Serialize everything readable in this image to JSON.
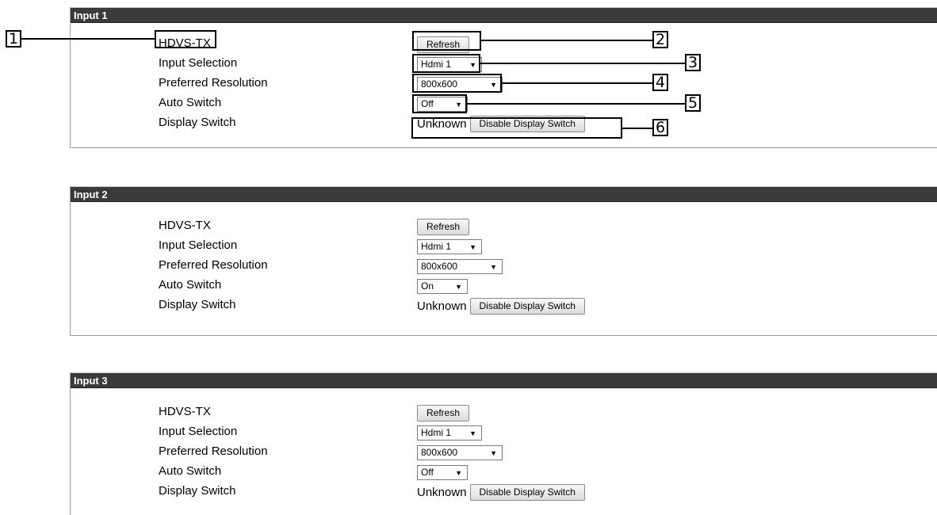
{
  "panels": [
    {
      "title": "Input 1",
      "rows": {
        "hdvs_label": "HDVS-TX",
        "refresh_label": "Refresh",
        "input_selection_label": "Input Selection",
        "input_selection_value": "Hdmi 1",
        "preferred_resolution_label": "Preferred Resolution",
        "preferred_resolution_value": "800x600",
        "auto_switch_label": "Auto Switch",
        "auto_switch_value": "Off",
        "display_switch_label": "Display Switch",
        "display_switch_status": "Unknown",
        "display_switch_button": "Disable Display Switch"
      }
    },
    {
      "title": "Input 2",
      "rows": {
        "hdvs_label": "HDVS-TX",
        "refresh_label": "Refresh",
        "input_selection_label": "Input Selection",
        "input_selection_value": "Hdmi 1",
        "preferred_resolution_label": "Preferred Resolution",
        "preferred_resolution_value": "800x600",
        "auto_switch_label": "Auto Switch",
        "auto_switch_value": "On",
        "display_switch_label": "Display Switch",
        "display_switch_status": "Unknown",
        "display_switch_button": "Disable Display Switch"
      }
    },
    {
      "title": "Input 3",
      "rows": {
        "hdvs_label": "HDVS-TX",
        "refresh_label": "Refresh",
        "input_selection_label": "Input Selection",
        "input_selection_value": "Hdmi 1",
        "preferred_resolution_label": "Preferred Resolution",
        "preferred_resolution_value": "800x600",
        "auto_switch_label": "Auto Switch",
        "auto_switch_value": "Off",
        "display_switch_label": "Display Switch",
        "display_switch_status": "Unknown",
        "display_switch_button": "Disable Display Switch"
      }
    }
  ],
  "callouts": [
    "1",
    "2",
    "3",
    "4",
    "5",
    "6"
  ],
  "icons": {
    "dropdown": "caret-down-icon"
  },
  "colors": {
    "header_bg": "#3a3a3a",
    "header_text": "#ffffff"
  }
}
